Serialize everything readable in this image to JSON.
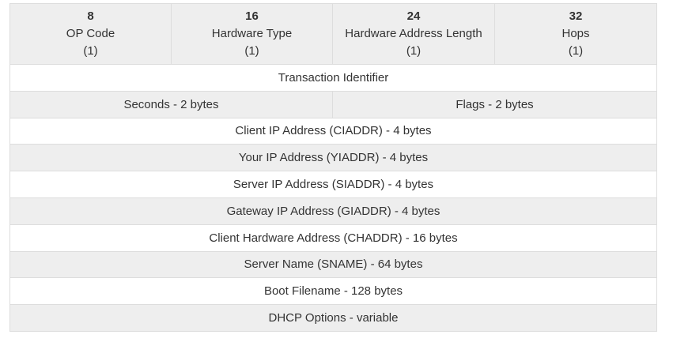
{
  "header_fields": [
    {
      "bit": "8",
      "name": "OP Code",
      "size": "(1)"
    },
    {
      "bit": "16",
      "name": "Hardware Type",
      "size": "(1)"
    },
    {
      "bit": "24",
      "name": "Hardware Address Length",
      "size": "(1)"
    },
    {
      "bit": "32",
      "name": "Hops",
      "size": "(1)"
    }
  ],
  "rows": {
    "transaction_id": "Transaction Identifier",
    "seconds": "Seconds - 2 bytes",
    "flags": "Flags - 2 bytes",
    "ciaddr": "Client IP Address (CIADDR) - 4 bytes",
    "yiaddr": "Your IP Address (YIADDR) - 4 bytes",
    "siaddr": "Server IP Address (SIADDR) - 4 bytes",
    "giaddr": "Gateway IP Address (GIADDR) - 4 bytes",
    "chaddr": "Client Hardware Address (CHADDR) - 16 bytes",
    "sname": "Server Name (SNAME) - 64 bytes",
    "boot_filename": "Boot Filename - 128 bytes",
    "dhcp_options": "DHCP Options - variable"
  },
  "colors": {
    "shaded_row": "#eeeeee",
    "plain_row": "#ffffff",
    "border": "#dddddd",
    "text": "#333333"
  }
}
